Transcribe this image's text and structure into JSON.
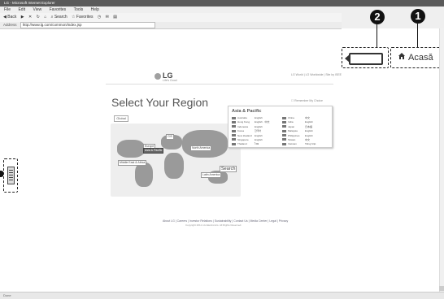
{
  "window": {
    "title": "LG - Microsoft Internet Explorer"
  },
  "menu": [
    "File",
    "Edit",
    "View",
    "Favorites",
    "Tools",
    "Help"
  ],
  "toolbar": {
    "back": "Back",
    "search": "Search",
    "favorites": "Favorites"
  },
  "address": {
    "label": "Address",
    "url": "http://www.lg.com/common/index.jsp"
  },
  "callouts": {
    "badge1": "1",
    "badge2": "2",
    "home_label": "Acasă"
  },
  "page": {
    "logo_text": "LG",
    "logo_tagline": "Life's Good",
    "top_links": "LG World | LG Worldwide | Site by ISEE",
    "heading": "Select Your Region",
    "remember": "Remember My Choice",
    "global_button": "Global",
    "map_labels": {
      "cis": "CIS",
      "europe": "Europe",
      "asia_pacific": "Asia & Pacific",
      "north_america": "North America",
      "middle_east": "Middle East & Africa",
      "latin_america": "Latin America"
    },
    "search_label": "Search",
    "region_panel": {
      "title": "Asia & Pacific",
      "countries": [
        {
          "name": "Australia",
          "lang": "English"
        },
        {
          "name": "China",
          "lang": "中文"
        },
        {
          "name": "Hong Kong",
          "lang": "English · 中文"
        },
        {
          "name": "India",
          "lang": "English"
        },
        {
          "name": "Indonesia",
          "lang": "English"
        },
        {
          "name": "Japan",
          "lang": "日本語"
        },
        {
          "name": "Korea",
          "lang": "한국어"
        },
        {
          "name": "Malaysia",
          "lang": "English"
        },
        {
          "name": "New Zealand",
          "lang": "English"
        },
        {
          "name": "Philippines",
          "lang": "English"
        },
        {
          "name": "Singapore",
          "lang": "English"
        },
        {
          "name": "Taiwan",
          "lang": "中文"
        },
        {
          "name": "Thailand",
          "lang": "ไทย"
        },
        {
          "name": "Vietnam",
          "lang": "Tiếng Việt"
        }
      ]
    },
    "footer_links": "About LG | Careers | Investor Relations | Sustainability | Contact Us | Media Center | Legal | Privacy",
    "copyright": "Copyright 2011 LG Electronics. All Rights Reserved."
  },
  "status": {
    "text": "Done"
  }
}
